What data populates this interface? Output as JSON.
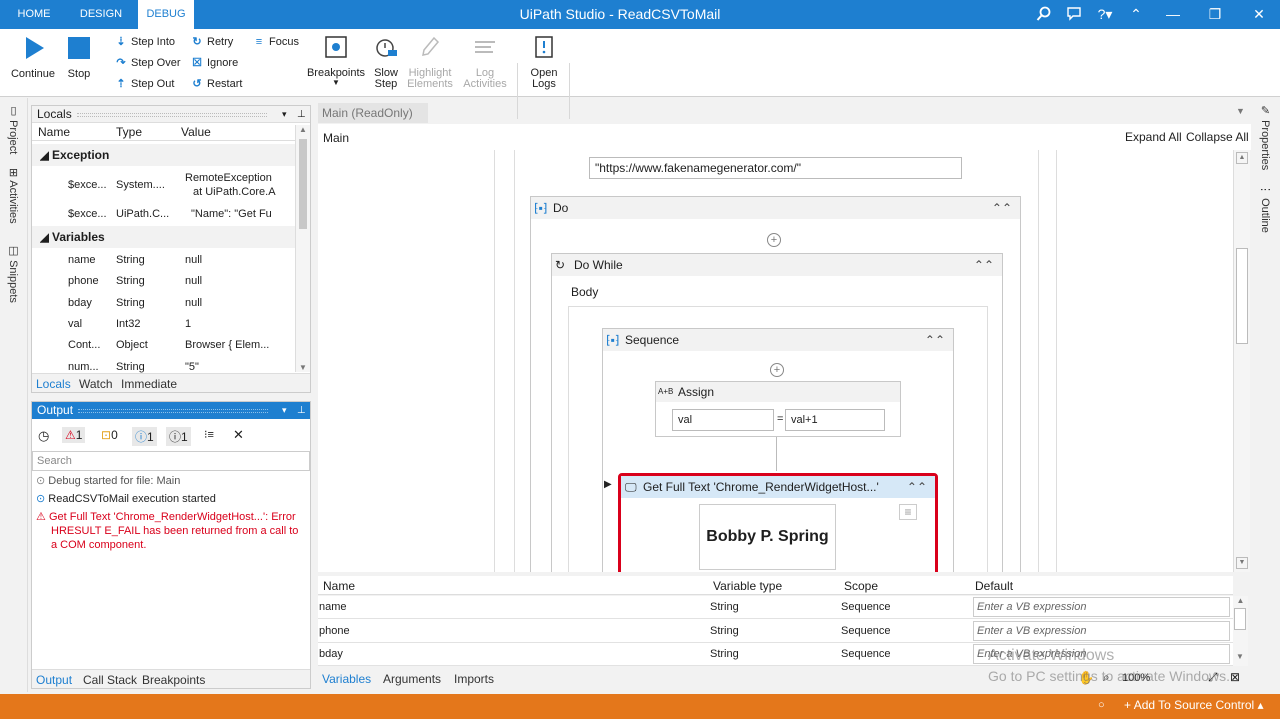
{
  "window": {
    "title": "UiPath Studio - ReadCSVToMail",
    "tabs": [
      "HOME",
      "DESIGN",
      "DEBUG"
    ]
  },
  "ribbon": {
    "continue": "Continue",
    "stop": "Stop",
    "step_into": "Step Into",
    "step_over": "Step Over",
    "step_out": "Step Out",
    "retry": "Retry",
    "ignore": "Ignore",
    "restart": "Restart",
    "focus": "Focus",
    "breakpoints": "Breakpoints",
    "slow_step_1": "Slow",
    "slow_step_2": "Step",
    "highlight_1": "Highlight",
    "highlight_2": "Elements",
    "log_1": "Log",
    "log_2": "Activities",
    "open_logs_1": "Open",
    "open_logs_2": "Logs"
  },
  "left_strip": [
    "Project",
    "Activities",
    "Snippets"
  ],
  "right_strip": [
    "Properties",
    "Outline"
  ],
  "locals": {
    "title": "Locals",
    "headers": [
      "Name",
      "Type",
      "Value"
    ],
    "exception_group": "Exception",
    "exception_rows": [
      {
        "name": "$exce...",
        "type": "System....",
        "value1": "RemoteException",
        "value2": "at UiPath.Core.A"
      },
      {
        "name": "$exce...",
        "type": "UiPath.C...",
        "value1": "\"Name\": \"Get Fu",
        "value2": ""
      }
    ],
    "variables_group": "Variables",
    "variable_rows": [
      {
        "name": "name",
        "type": "String",
        "value": "null"
      },
      {
        "name": "phone",
        "type": "String",
        "value": "null"
      },
      {
        "name": "bday",
        "type": "String",
        "value": "null"
      },
      {
        "name": "val",
        "type": "Int32",
        "value": "1"
      },
      {
        "name": "Cont...",
        "type": "Object",
        "value": "Browser { Elem..."
      },
      {
        "name": "num...",
        "type": "String",
        "value": "\"5\""
      }
    ],
    "tabs": [
      "Locals",
      "Watch",
      "Immediate"
    ]
  },
  "output": {
    "title": "Output",
    "counts": {
      "errors": "1",
      "warnings": "0",
      "info": "1",
      "trace": "1"
    },
    "search_placeholder": "Search",
    "messages": [
      {
        "text": "Debug started for file: Main"
      },
      {
        "text": "ReadCSVToMail execution started"
      },
      {
        "text": "Get Full Text 'Chrome_RenderWidgetHost...': Error HRESULT E_FAIL has been returned from a call to a COM component."
      }
    ],
    "tabs": [
      "Output",
      "Call Stack",
      "Breakpoints"
    ]
  },
  "designer": {
    "doc_tab": "Main (ReadOnly)",
    "breadcrumb": "Main",
    "expand_all": "Expand All",
    "collapse_all": "Collapse All",
    "url_value": "\"https://www.fakenamegenerator.com/\"",
    "do_label": "Do",
    "do_while_label": "Do While",
    "body_label": "Body",
    "sequence_label": "Sequence",
    "assign_label": "Assign",
    "assign_badge": "A+B",
    "assign_to": "val",
    "assign_eq": "=",
    "assign_value": "val+1",
    "get_text_label": "Get Full Text 'Chrome_RenderWidgetHost...'",
    "preview_text": "Bobby P. Spring"
  },
  "variables_panel": {
    "headers": [
      "Name",
      "Variable type",
      "Scope",
      "Default"
    ],
    "rows": [
      {
        "name": "name",
        "type": "String",
        "scope": "Sequence",
        "default": "Enter a VB expression"
      },
      {
        "name": "phone",
        "type": "String",
        "scope": "Sequence",
        "default": "Enter a VB expression"
      },
      {
        "name": "bday",
        "type": "String",
        "scope": "Sequence",
        "default": "Enter a VB expression"
      }
    ],
    "tabs": [
      "Variables",
      "Arguments",
      "Imports"
    ],
    "zoom": "100%"
  },
  "watermark": {
    "line1": "Activate Windows",
    "line2": "Go to PC settings to activate Windows."
  },
  "status": {
    "add_to_source": "Add To Source Control"
  },
  "colors": {
    "accent": "#1e7fd0",
    "status_bar": "#e4771b",
    "error": "#d9001b",
    "highlight_border": "#d9001b"
  }
}
